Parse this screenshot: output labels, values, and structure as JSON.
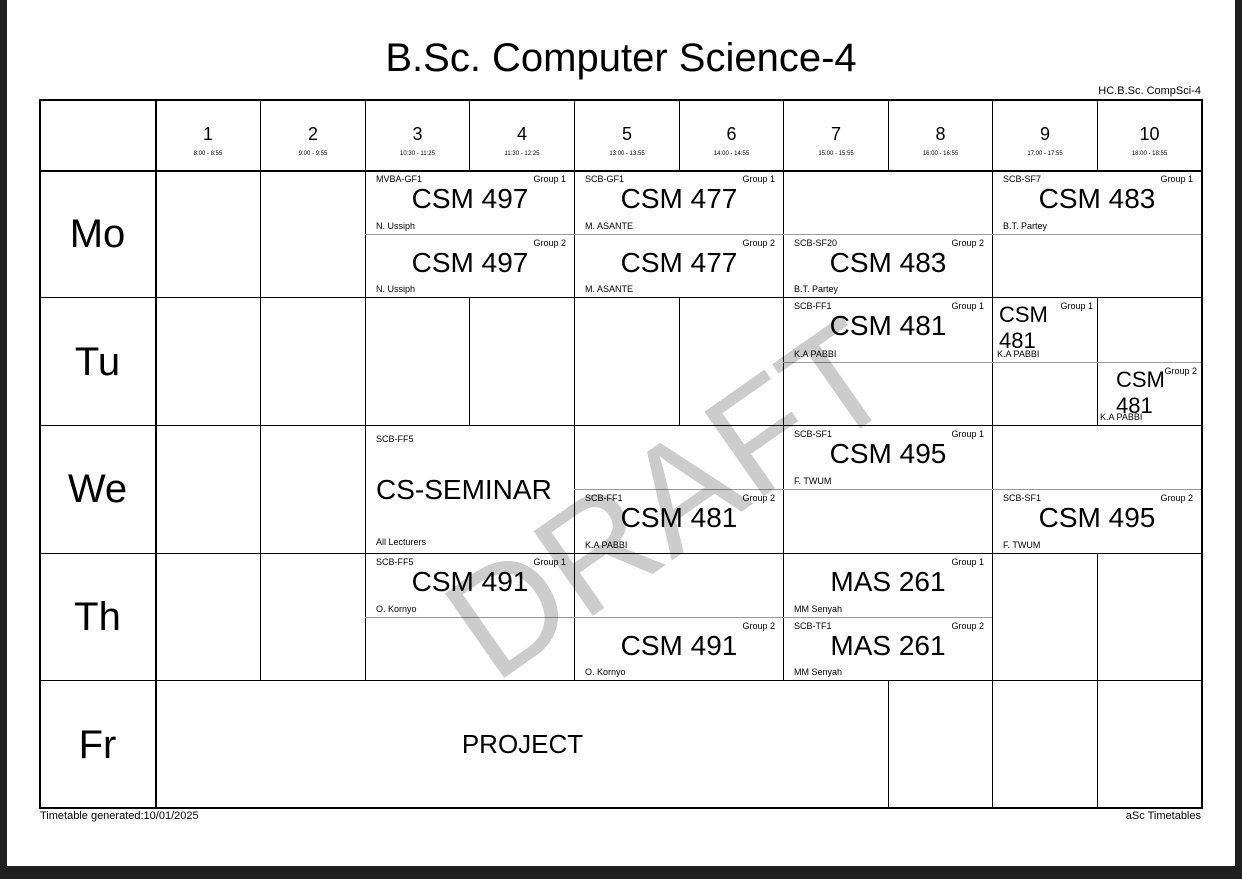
{
  "title": "B.Sc. Computer Science-4",
  "code": "HC.B.Sc. CompSci-4",
  "watermark": "DRAFT",
  "footer": {
    "generated": "Timetable generated:10/01/2025",
    "vendor": "aSc Timetables"
  },
  "periods": [
    {
      "num": "1",
      "time": "8:00 - 8:55"
    },
    {
      "num": "2",
      "time": "9:00 - 9:55"
    },
    {
      "num": "3",
      "time": "10:30 - 11:25"
    },
    {
      "num": "4",
      "time": "11:30 - 12:25"
    },
    {
      "num": "5",
      "time": "13:00 - 13:55"
    },
    {
      "num": "6",
      "time": "14:00 - 14:55"
    },
    {
      "num": "7",
      "time": "15:00 - 15:55"
    },
    {
      "num": "8",
      "time": "16:00 - 16:55"
    },
    {
      "num": "9",
      "time": "17:00 - 17:55"
    },
    {
      "num": "10",
      "time": "18:00 - 18:55"
    }
  ],
  "days": [
    "Mo",
    "Tu",
    "We",
    "Th",
    "Fr"
  ],
  "lessons": {
    "mo_497_g1": {
      "room": "MVBA-GF1",
      "group": "Group 1",
      "subject": "CSM 497",
      "lecturer": "N. Ussiph"
    },
    "mo_477_g1": {
      "room": "SCB-GF1",
      "group": "Group 1",
      "subject": "CSM 477",
      "lecturer": "M. ASANTE"
    },
    "mo_483_g1": {
      "room": "SCB-SF7",
      "group": "Group 1",
      "subject": "CSM 483",
      "lecturer": "B.T. Partey"
    },
    "mo_497_g2": {
      "room": "",
      "group": "Group 2",
      "subject": "CSM 497",
      "lecturer": "N. Ussiph"
    },
    "mo_477_g2": {
      "room": "",
      "group": "Group 2",
      "subject": "CSM 477",
      "lecturer": "M. ASANTE"
    },
    "mo_483_g2": {
      "room": "SCB-SF20",
      "group": "Group 2",
      "subject": "CSM 483",
      "lecturer": "B.T. Partey"
    },
    "tu_481_g1": {
      "room": "SCB-FF1",
      "group": "Group 1",
      "subject": "CSM 481",
      "lecturer": "K.A PABBI"
    },
    "tu_481_g1b": {
      "room": "",
      "group": "Group 1",
      "subject": "CSM 481",
      "lecturer": "K.A PABBI"
    },
    "tu_481_g2": {
      "room": "",
      "group": "Group 2",
      "subject": "CSM 481",
      "lecturer": "K.A PABBI"
    },
    "we_seminar": {
      "room": "SCB-FF5",
      "group": "",
      "subject": "CS-SEMINAR",
      "lecturer": "All  Lecturers"
    },
    "we_495_g1": {
      "room": "SCB-SF1",
      "group": "Group 1",
      "subject": "CSM 495",
      "lecturer": "F. TWUM"
    },
    "we_481_g2": {
      "room": "SCB-FF1",
      "group": "Group 2",
      "subject": "CSM 481",
      "lecturer": "K.A PABBI"
    },
    "we_495_g2": {
      "room": "SCB-SF1",
      "group": "Group 2",
      "subject": "CSM 495",
      "lecturer": "F. TWUM"
    },
    "th_491_g1": {
      "room": "SCB-FF5",
      "group": "Group 1",
      "subject": "CSM 491",
      "lecturer": "O. Kornyo"
    },
    "th_mas_g1": {
      "room": "",
      "group": "Group 1",
      "subject": "MAS 261",
      "lecturer": "MM Senyah"
    },
    "th_491_g2": {
      "room": "",
      "group": "Group 2",
      "subject": "CSM 491",
      "lecturer": "O. Kornyo"
    },
    "th_mas_g2": {
      "room": "SCB-TF1",
      "group": "Group 2",
      "subject": "MAS 261",
      "lecturer": "MM Senyah"
    },
    "fr_project": {
      "subject": "PROJECT"
    }
  }
}
